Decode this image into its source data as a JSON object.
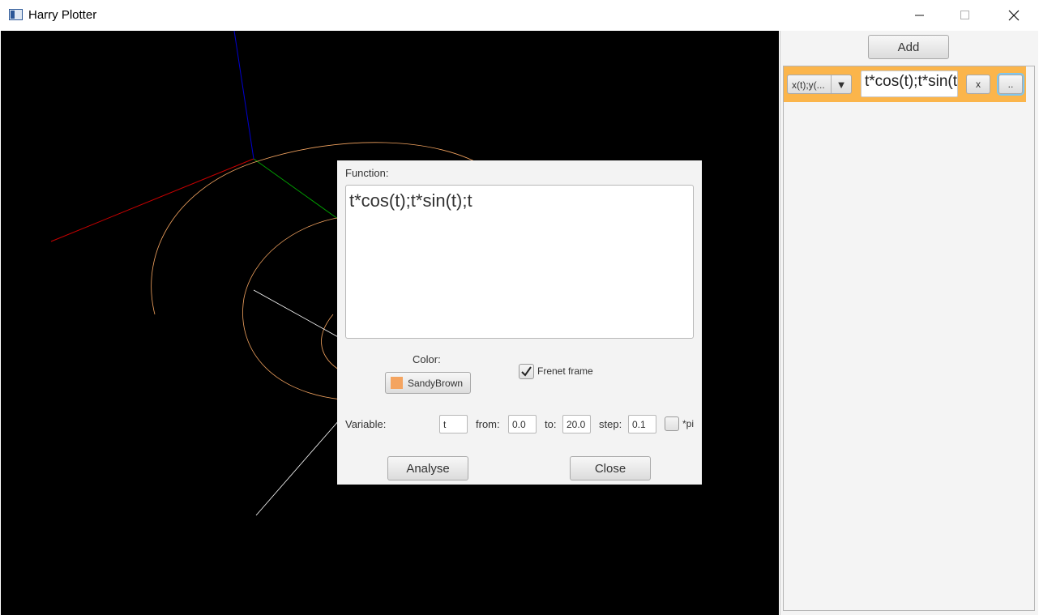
{
  "window": {
    "title": "Harry Plotter",
    "controls": {
      "minimize": "─",
      "maximize": "☐",
      "close": "✕"
    }
  },
  "plot": {
    "curve_color": "#f4a460",
    "axes_colors": {
      "x": "#ff0000",
      "y": "#00a000",
      "z": "#0000ff"
    },
    "frenet_line_color": "#ffffff"
  },
  "side_panel": {
    "add_label": "Add",
    "functions": [
      {
        "type": "x(t);y(...",
        "type_arrow": "▼",
        "expression": "t*cos(t);t*sin(t);t",
        "remove_label": "x",
        "more_label": "..",
        "row_color": "#fbb54b"
      }
    ]
  },
  "dialog": {
    "function_label": "Function:",
    "function_value": "t*cos(t);t*sin(t);t",
    "color_label": "Color:",
    "color_name": "SandyBrown",
    "color_hex": "#f4a460",
    "frenet_label": "Frenet frame",
    "frenet_checked": true,
    "variable_label": "Variable:",
    "variable_value": "t",
    "from_label": "from:",
    "from_value": "0.0",
    "to_label": "to:",
    "to_value": "20.0",
    "step_label": "step:",
    "step_value": "0.1",
    "pi_label": "*pi",
    "pi_checked": false,
    "analyse_label": "Analyse",
    "close_label": "Close"
  }
}
